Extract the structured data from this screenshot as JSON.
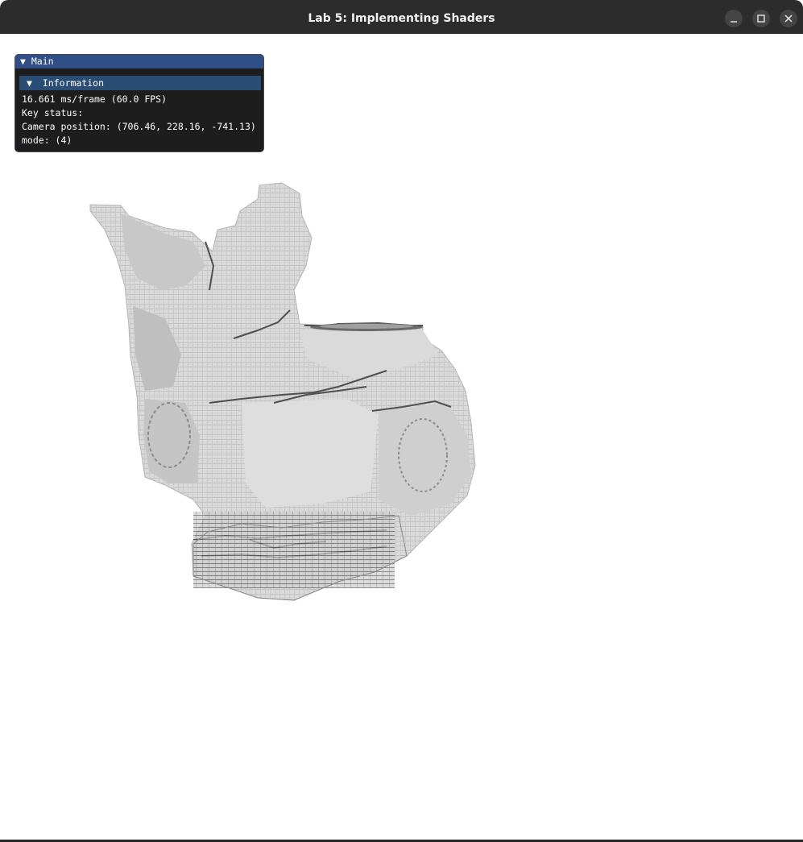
{
  "window": {
    "title": "Lab 5: Implementing Shaders",
    "buttons": {
      "minimize_icon": "minimize-icon",
      "maximize_icon": "maximize-icon",
      "close_icon": "close-icon"
    }
  },
  "imgui": {
    "panel_title": "Main",
    "section_title": "Information",
    "arrow": "▼",
    "lines": {
      "frametime": "16.661 ms/frame (60.0 FPS)",
      "key_status": "Key status:",
      "camera_position": "Camera position: (706.46, 228.16, -741.13)",
      "mode": "mode: (4)"
    }
  },
  "colors": {
    "titlebar": "#2c2c2c",
    "panel_header": "#2f4f86",
    "section_header": "#294d75",
    "panel_bg": "#1d1d1e",
    "model_light": "#d9d9d9",
    "model_shadow": "#555555"
  }
}
